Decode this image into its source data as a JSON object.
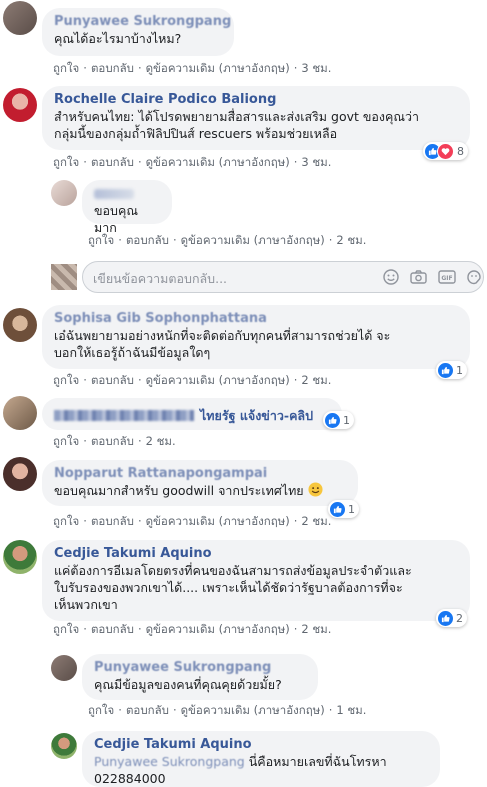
{
  "comments": [
    {
      "author": "Punyawee Sukrongpang",
      "text": [
        "คุณได้อะไรมาบ้างไหม?"
      ],
      "time": "3 ชม."
    },
    {
      "author": "Rochelle Claire Podico Baliong",
      "text": [
        "สำหรับคนไทย: ได้โปรดพยายามสื่อสารและส่งเสริม govt ของคุณว่า",
        "กลุ่มนี้ของกลุ่มถ้ำฟิลิปปินส์ rescuers พร้อมช่วยเหลือ"
      ],
      "time": "3 ชม.",
      "reactions": "8"
    },
    {
      "author": "",
      "text": [
        "ขอบคุณมาก"
      ],
      "time": "2 ชม."
    },
    {
      "author": "Sophisa Gib Sophonphattana",
      "text": [
        "เอ๋ฉันพยายามอย่างหนักที่จะติดต่อกับทุกคนที่สามารถช่วยได้ จะ",
        "บอกให้เธอรู้ถ้าฉันมีข้อมูลใดๆ"
      ],
      "time": "2 ชม.",
      "reactions": "1"
    },
    {
      "author": "ไทยรัฐ แจ้งข่าว-คลิป",
      "text": [],
      "time": "2 ชม.",
      "reactions": "1"
    },
    {
      "author": "Nopparut Rattanapongampai",
      "text": [
        "ขอบคุณมากสำหรับ goodwill จากประเทศไทย"
      ],
      "time": "2 ชม.",
      "reactions": "1"
    },
    {
      "author": "Cedjie Takumi Aquino",
      "text": [
        "แค่ต้องการอีเมลโดยตรงที่คนของฉันสามารถส่งข้อมูลประจำตัวและ",
        "ใบรับรองของพวกเขาได้.... เพราะเห็นได้ชัดว่ารัฐบาลต้องการที่จะ",
        "เห็นพวกเขา"
      ],
      "time": "2 ชม.",
      "reactions": "2"
    },
    {
      "author": "Punyawee Sukrongpang",
      "text": [
        "คุณมีข้อมูลของคนที่คุณคุยด้วยมั้ย?"
      ],
      "time": "1 ชม."
    },
    {
      "author": "Cedjie Takumi Aquino",
      "mention": "Punyawee Sukrongpang",
      "text": [
        "นี่คือหมายเลขที่ฉันโทรหา",
        "022884000"
      ]
    }
  ],
  "actions": {
    "like": "ถูกใจ",
    "reply": "ตอบกลับ",
    "translate": "ดูข้อความเดิม (ภาษาอังกฤษ)",
    "dot": "·"
  },
  "reply_placeholder": "เขียนข้อความตอบกลับ...",
  "colors": {
    "link": "#385898",
    "meta": "#606770",
    "bubble": "#f2f3f5",
    "like": "#1877f2",
    "love": "#f33e58"
  }
}
